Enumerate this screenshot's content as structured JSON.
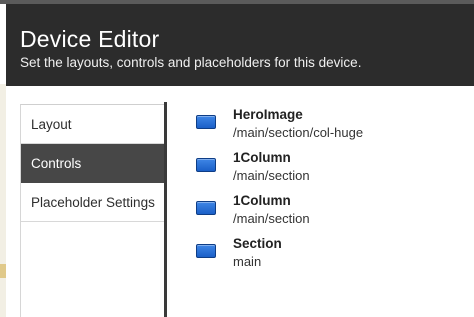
{
  "dialog": {
    "title": "Device Editor",
    "subtitle": "Set the layouts, controls and placeholders for this device."
  },
  "tabs": [
    {
      "label": "Layout",
      "active": false
    },
    {
      "label": "Controls",
      "active": true
    },
    {
      "label": "Placeholder Settings",
      "active": false
    }
  ],
  "renderings": [
    {
      "name": "HeroImage",
      "path": "/main/section/col-huge",
      "icon": "rendering-icon"
    },
    {
      "name": "1Column",
      "path": "/main/section",
      "icon": "rendering-icon"
    },
    {
      "name": "1Column",
      "path": "/main/section",
      "icon": "rendering-icon"
    },
    {
      "name": "Section",
      "path": "main",
      "icon": "rendering-icon"
    }
  ],
  "colors": {
    "header_bg": "#2c2c2c",
    "active_tab_bg": "#474747",
    "icon_blue": "#2a6fd6"
  }
}
